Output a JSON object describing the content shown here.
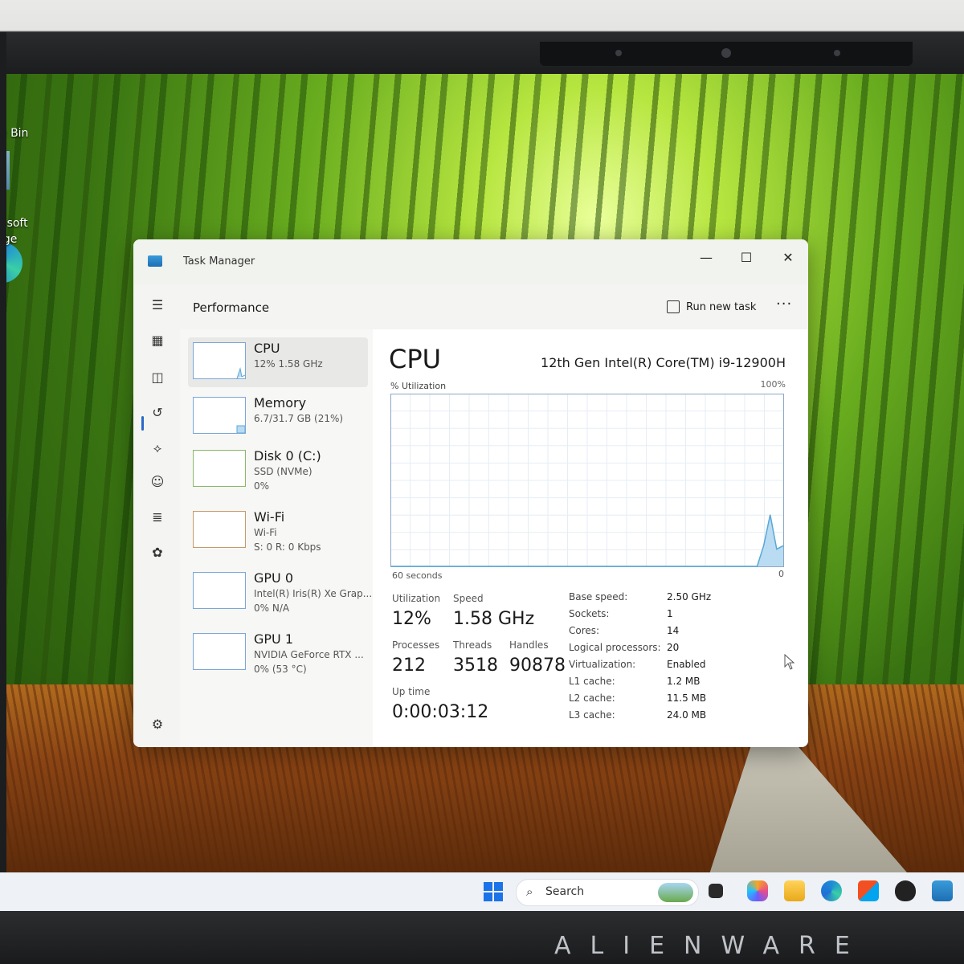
{
  "desktop": {
    "recycle_bin_label": "e Bin",
    "edge_label_line1": "osoft",
    "edge_label_line2": "ige"
  },
  "window": {
    "title": "Task Manager",
    "minimize": "—",
    "maximize": "☐",
    "close": "✕"
  },
  "header": {
    "page_title": "Performance",
    "run_new_task": "Run new task",
    "more": "···"
  },
  "sidebar_icons": [
    "menu-icon",
    "processes-icon",
    "performance-icon",
    "app-history-icon",
    "startup-icon",
    "users-icon",
    "details-icon",
    "services-icon",
    "settings-icon"
  ],
  "devices": [
    {
      "name": "CPU",
      "sub": "12%  1.58 GHz",
      "sub2": ""
    },
    {
      "name": "Memory",
      "sub": "6.7/31.7 GB (21%)",
      "sub2": ""
    },
    {
      "name": "Disk 0 (C:)",
      "sub": "SSD (NVMe)",
      "sub2": "0%"
    },
    {
      "name": "Wi-Fi",
      "sub": "Wi-Fi",
      "sub2": "S: 0  R: 0 Kbps"
    },
    {
      "name": "GPU 0",
      "sub": "Intel(R) Iris(R) Xe Grap...",
      "sub2": "0%  N/A"
    },
    {
      "name": "GPU 1",
      "sub": "NVIDIA GeForce RTX ...",
      "sub2": "0%  (53 °C)"
    }
  ],
  "cpu": {
    "heading": "CPU",
    "model": "12th Gen Intel(R) Core(TM) i9-12900H",
    "util_label": "% Utilization",
    "util_max": "100%",
    "axis_left": "60 seconds",
    "axis_right": "0",
    "graph_values": [
      0,
      0,
      0,
      0,
      0,
      0,
      0,
      0,
      0,
      0,
      0,
      0,
      0,
      0,
      0,
      0,
      0,
      0,
      0,
      0,
      0,
      0,
      0,
      0,
      0,
      0,
      0,
      0,
      0,
      0,
      0,
      0,
      0,
      0,
      0,
      0,
      0,
      0,
      0,
      0,
      0,
      0,
      0,
      0,
      0,
      0,
      0,
      0,
      0,
      0,
      0,
      0,
      0,
      0,
      0,
      0,
      0,
      12,
      30,
      10,
      12
    ],
    "stats": {
      "utilization_label": "Utilization",
      "utilization": "12%",
      "speed_label": "Speed",
      "speed": "1.58 GHz",
      "processes_label": "Processes",
      "processes": "212",
      "threads_label": "Threads",
      "threads": "3518",
      "handles_label": "Handles",
      "handles": "90878",
      "uptime_label": "Up time",
      "uptime": "0:00:03:12"
    },
    "specs": [
      {
        "k": "Base speed:",
        "v": "2.50 GHz"
      },
      {
        "k": "Sockets:",
        "v": "1"
      },
      {
        "k": "Cores:",
        "v": "14"
      },
      {
        "k": "Logical processors:",
        "v": "20"
      },
      {
        "k": "Virtualization:",
        "v": "Enabled"
      },
      {
        "k": "L1 cache:",
        "v": "1.2 MB"
      },
      {
        "k": "L2 cache:",
        "v": "11.5 MB"
      },
      {
        "k": "L3 cache:",
        "v": "24.0 MB"
      }
    ]
  },
  "taskbar": {
    "search_placeholder": "Search"
  },
  "brand": "ALIENWARE",
  "colors": {
    "accent": "#2a6ac8",
    "graph_line": "#5aa7d8",
    "graph_fill": "#b9dcf2"
  }
}
